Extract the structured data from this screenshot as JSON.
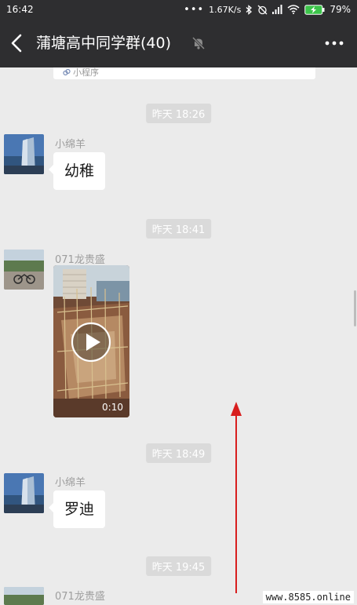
{
  "status_bar": {
    "time": "16:42",
    "dots": "•••",
    "network_speed": "1.67K/s",
    "battery": "79%",
    "icons": [
      "bluetooth-icon",
      "alarm-off-icon",
      "signal-icon",
      "wifi-icon",
      "battery-charging-icon"
    ]
  },
  "header": {
    "back_icon": "chevron-left-icon",
    "title": "蒲塘高中同学群(40)",
    "mute_icon": "bell-muted-icon",
    "more_icon": "more-dots-icon"
  },
  "card_remnant": {
    "label": "小程序"
  },
  "messages": [
    {
      "type": "timestamp",
      "text": "昨天 18:26"
    },
    {
      "type": "text",
      "sender": "小绵羊",
      "text": "幼稚"
    },
    {
      "type": "timestamp",
      "text": "昨天 18:41"
    },
    {
      "type": "video",
      "sender": "071龙贵盛",
      "duration": "0:10"
    },
    {
      "type": "timestamp",
      "text": "昨天 18:49"
    },
    {
      "type": "text",
      "sender": "小绵羊",
      "text": "罗迪"
    },
    {
      "type": "timestamp",
      "text": "昨天 19:45"
    },
    {
      "type": "partial",
      "sender": "071龙贵盛"
    }
  ],
  "watermark": "www.8585.online",
  "colors": {
    "header_bg": "#2e2e30",
    "chat_bg": "#ebebeb",
    "timestamp_bg": "#dadada",
    "annotation_arrow": "#d81e1e"
  }
}
